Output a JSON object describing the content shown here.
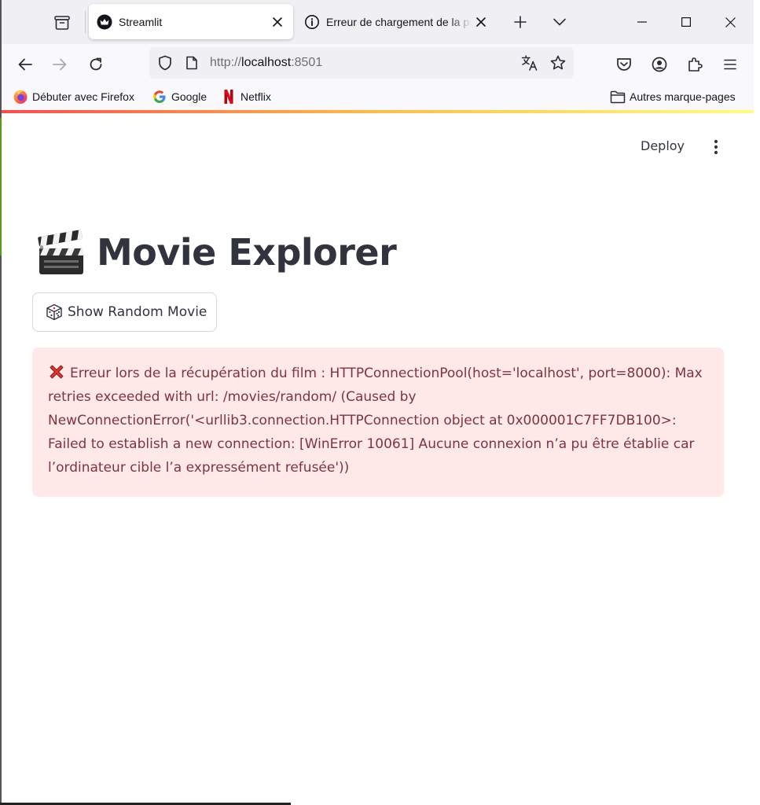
{
  "browser": {
    "tabs": [
      {
        "label": "Streamlit",
        "favicon": "streamlit-crown-icon",
        "active": true
      },
      {
        "label": "Erreur de chargement de la page",
        "favicon": "info-circle-icon",
        "active": false
      }
    ],
    "url": {
      "scheme": "http://",
      "host": "localhost",
      "port": ":8501"
    },
    "bookmarks": [
      {
        "label": "Débuter avec Firefox",
        "icon": "firefox-icon"
      },
      {
        "label": "Google",
        "icon": "google-icon"
      },
      {
        "label": "Netflix",
        "icon": "netflix-icon"
      }
    ],
    "other_bookmarks": "Autres marque-pages"
  },
  "app": {
    "deploy_label": "Deploy",
    "title": "Movie Explorer",
    "title_icon": "clapper-board-icon",
    "random_button": {
      "icon": "dice-icon",
      "label": "Show Random Movie"
    },
    "error": {
      "icon": "cross-mark-icon",
      "message": "Erreur lors de la récupération du film : HTTPConnectionPool(host='localhost', port=8000): Max retries exceeded with url: /movies/random/ (Caused by NewConnectionError('<urllib3.connection.HTTPConnection object at 0x000001C7FF7DB100>: Failed to establish a new connection: [WinError 10061] Aucune connexion n’a pu être établie car l’ordinateur cible l’a expressément refusée'))"
    }
  },
  "colors": {
    "error_bg": "#ffe8e8",
    "error_text": "#7d353b",
    "title_text": "#31333f",
    "accent_gradient": [
      "#ff4b4b",
      "#ffbd45",
      "#fffd80"
    ]
  }
}
